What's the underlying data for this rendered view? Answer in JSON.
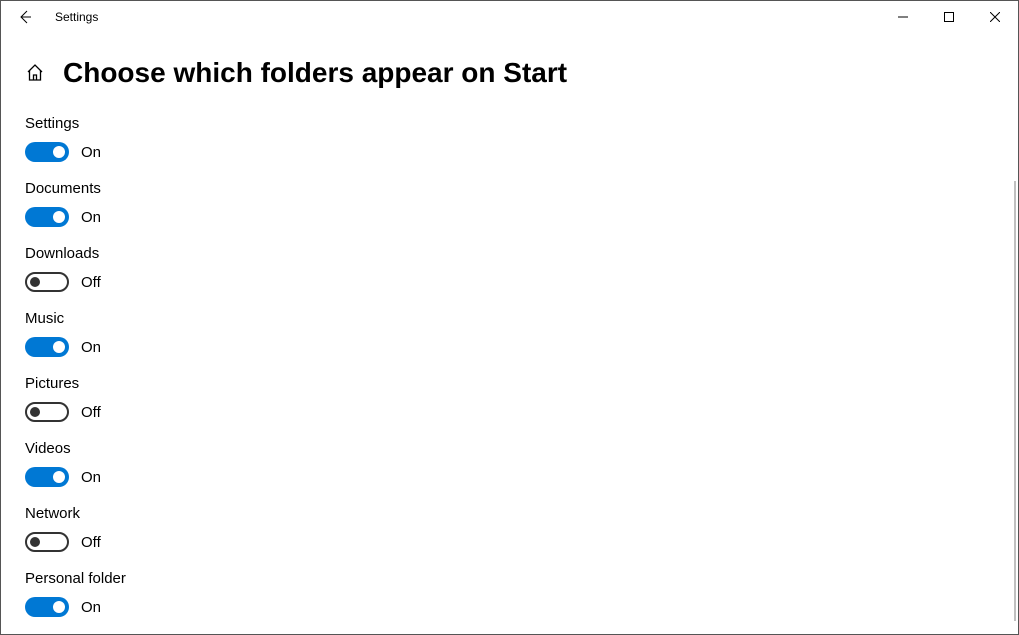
{
  "app_title": "Settings",
  "page_title": "Choose which folders appear on Start",
  "state_labels": {
    "on": "On",
    "off": "Off"
  },
  "options": [
    {
      "id": "settings",
      "label": "Settings",
      "on": true
    },
    {
      "id": "documents",
      "label": "Documents",
      "on": true
    },
    {
      "id": "downloads",
      "label": "Downloads",
      "on": false
    },
    {
      "id": "music",
      "label": "Music",
      "on": true
    },
    {
      "id": "pictures",
      "label": "Pictures",
      "on": false
    },
    {
      "id": "videos",
      "label": "Videos",
      "on": true
    },
    {
      "id": "network",
      "label": "Network",
      "on": false
    },
    {
      "id": "personal-folder",
      "label": "Personal folder",
      "on": true
    }
  ],
  "colors": {
    "accent": "#0078d4"
  }
}
